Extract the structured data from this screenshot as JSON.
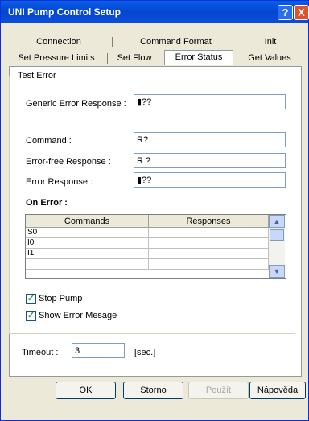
{
  "window": {
    "title": "UNI Pump Control Setup",
    "help_glyph": "?",
    "close_glyph": "X"
  },
  "tabs": {
    "row1": [
      "Connection",
      "Command Format",
      "Init"
    ],
    "row2": [
      "Set Pressure Limits",
      "Set Flow",
      "Error Status",
      "Get Values"
    ],
    "active": "Error Status"
  },
  "test_error": {
    "group_label": "Test Error",
    "generic_label": "Generic Error Response :",
    "generic_value": "▮??",
    "command_label": "Command :",
    "command_value": "R?",
    "errorfree_label": "Error-free Response :",
    "errorfree_value": "R ?",
    "error_response_label": "Error Response :",
    "error_response_value": "▮??"
  },
  "on_error": {
    "label": "On Error :",
    "columns": [
      "Commands",
      "Responses"
    ],
    "rows": [
      [
        "S0",
        ""
      ],
      [
        "I0",
        ""
      ],
      [
        "I1",
        ""
      ],
      [
        "",
        ""
      ]
    ]
  },
  "options": {
    "stop_pump_label": "Stop Pump",
    "stop_pump_checked": true,
    "show_error_label": "Show Error Mesage",
    "show_error_checked": true
  },
  "timeout": {
    "label": "Timeout :",
    "value": "3",
    "unit": "[sec.]"
  },
  "buttons": {
    "ok": "OK",
    "cancel": "Storno",
    "apply": "Použít",
    "help": "Nápověda"
  }
}
